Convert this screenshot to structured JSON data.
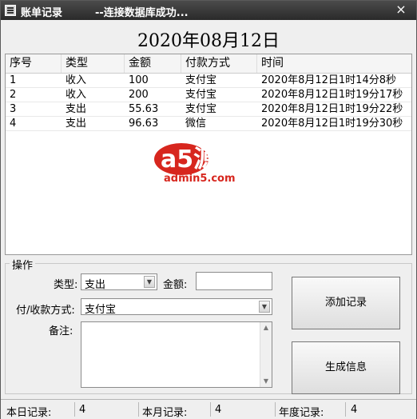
{
  "window": {
    "title": "账单记录",
    "status": "--连接数据库成功...",
    "close_symbol": "×"
  },
  "date_title": "2020年08月12日",
  "table": {
    "columns": [
      "序号",
      "类型",
      "金额",
      "付款方式",
      "时间"
    ],
    "rows": [
      [
        "1",
        "收入",
        "100",
        "支付宝",
        "2020年8月12日1时14分8秒"
      ],
      [
        "2",
        "收入",
        "200",
        "支付宝",
        "2020年8月12日1时19分17秒"
      ],
      [
        "3",
        "支出",
        "55.63",
        "支付宝",
        "2020年8月12日1时19分22秒"
      ],
      [
        "4",
        "支出",
        "96.63",
        "微信",
        "2020年8月12日1时19分30秒"
      ]
    ]
  },
  "watermark": {
    "logo_text": "a5源码",
    "site": "admin5.com",
    "colors": {
      "red": "#d7261e",
      "dark": "#222222"
    }
  },
  "form": {
    "group_title": "操作",
    "type_label": "类型:",
    "type_value": "支出",
    "amount_label": "金额:",
    "amount_value": "",
    "payment_label": "付/收款方式:",
    "payment_value": "支付宝",
    "note_label": "备注:",
    "note_value": "",
    "add_button": "添加记录",
    "generate_button": "生成信息"
  },
  "statusbar": {
    "today_label": "本日记录:",
    "today_value": "4",
    "month_label": "本月记录:",
    "month_value": "4",
    "year_label": "年度记录:",
    "year_value": "4"
  }
}
